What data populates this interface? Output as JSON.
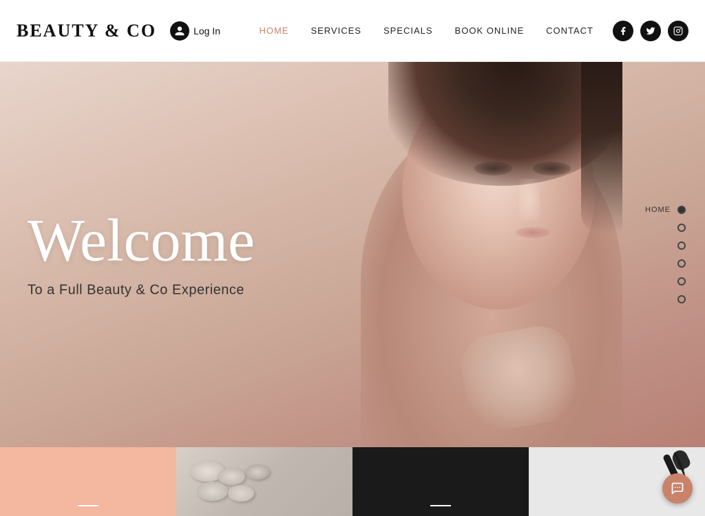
{
  "header": {
    "logo": "BEAUTY & Co",
    "login": "Log In",
    "nav": [
      {
        "label": "HOME",
        "active": true
      },
      {
        "label": "SERVICES",
        "active": false
      },
      {
        "label": "SPECIALS",
        "active": false
      },
      {
        "label": "BOOK ONLINE",
        "active": false
      },
      {
        "label": "CONTACT",
        "active": false
      }
    ],
    "social": [
      {
        "name": "facebook",
        "icon": "f-icon"
      },
      {
        "name": "twitter",
        "icon": "t-icon"
      },
      {
        "name": "instagram",
        "icon": "i-icon"
      }
    ]
  },
  "hero": {
    "welcome": "Welcome",
    "subtitle": "To a Full Beauty & Co Experience"
  },
  "side_nav": {
    "items": [
      {
        "label": "HOME",
        "active": true
      },
      {
        "label": "",
        "active": false
      },
      {
        "label": "",
        "active": false
      },
      {
        "label": "",
        "active": false
      },
      {
        "label": "",
        "active": false
      },
      {
        "label": "",
        "active": false
      }
    ]
  },
  "bottom_tiles": [
    {
      "id": "tile-1",
      "bg": "#f4b8a0",
      "dash_color": "white"
    },
    {
      "id": "tile-2",
      "bg": "spa-image",
      "dash_color": "none"
    },
    {
      "id": "tile-3",
      "bg": "#1a1a1a",
      "dash_color": "white"
    },
    {
      "id": "tile-4",
      "bg": "mascara-image",
      "dash_color": "dark"
    }
  ],
  "chat": {
    "label": "···"
  }
}
